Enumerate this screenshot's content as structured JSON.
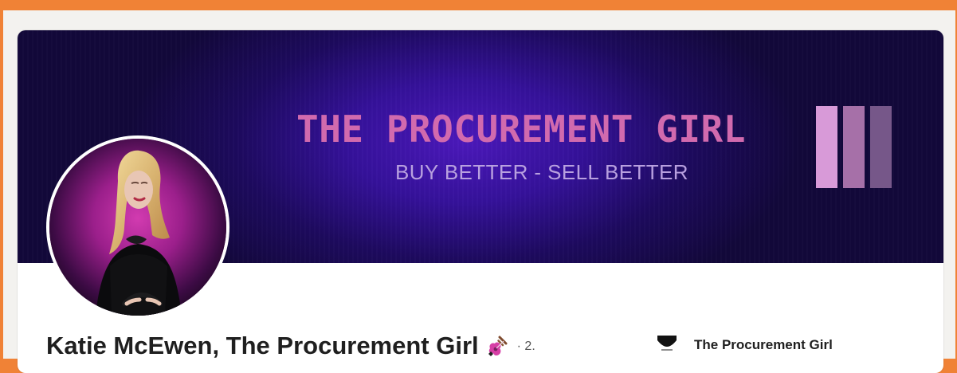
{
  "banner": {
    "title": "THE PROCUREMENT GIRL",
    "tagline": "BUY BETTER - SELL BETTER"
  },
  "profile": {
    "name": "Katie McEwen, The Procurement Girl",
    "degree": "· 2."
  },
  "company": {
    "name": "The Procurement Girl"
  },
  "colors": {
    "accent_border": "#f08236",
    "banner_bg": "#35119a",
    "banner_title": "#d16aae",
    "banner_tagline": "#b8a0df",
    "bar_one": "#d89ad8",
    "bar_two": "#a670a8",
    "bar_three": "#765789"
  },
  "icons": {
    "profile_name_icon": "guitar-icon",
    "company_logo_icon": "company-logo-icon"
  }
}
